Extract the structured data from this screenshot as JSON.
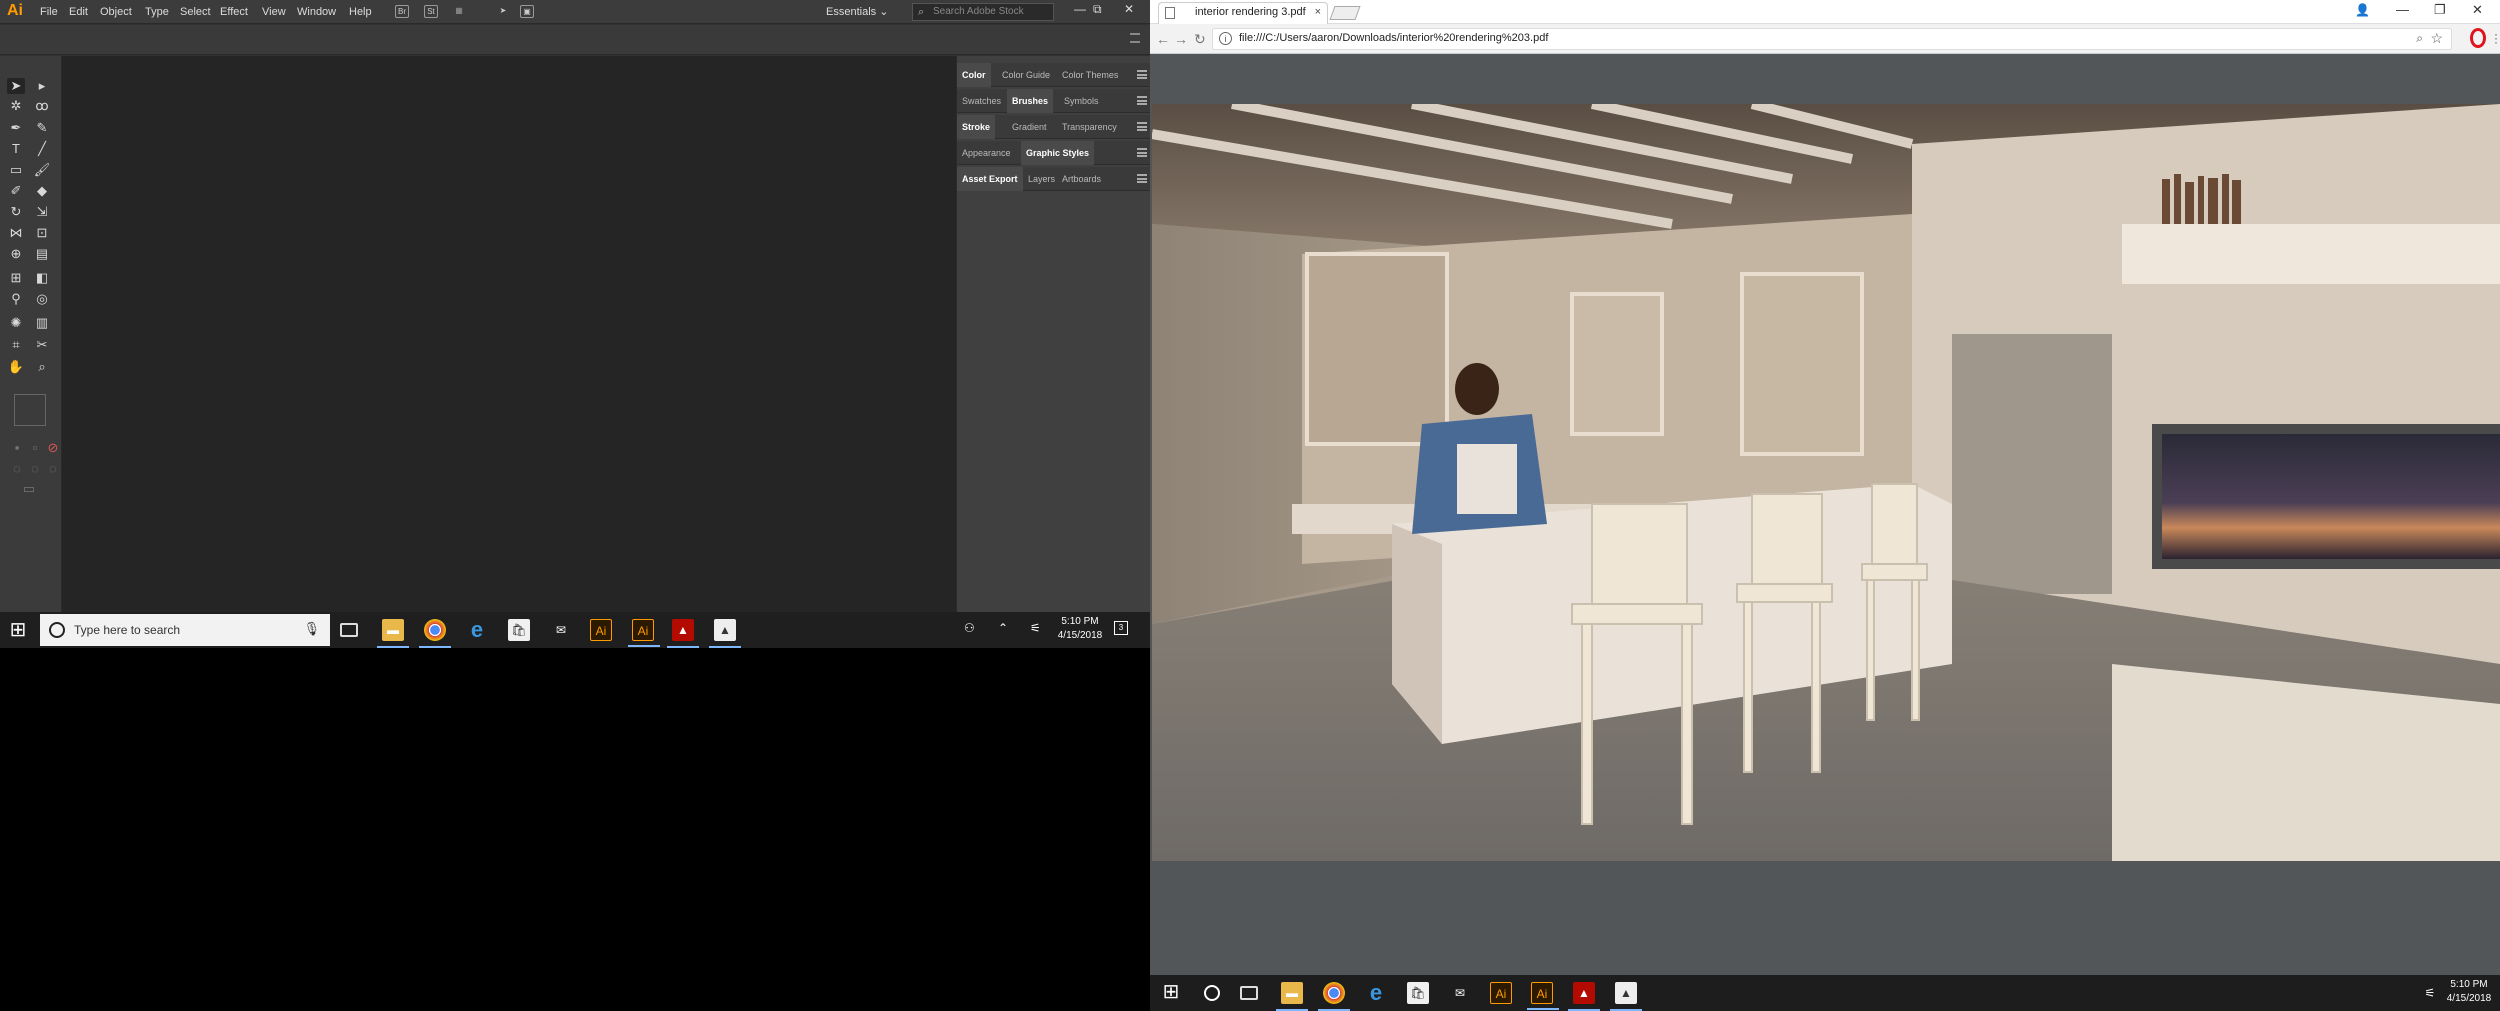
{
  "illustrator": {
    "logo": "Ai",
    "menus": [
      "File",
      "Edit",
      "Object",
      "Type",
      "Select",
      "Effect",
      "View",
      "Window",
      "Help"
    ],
    "toolbar_buttons": [
      "Br",
      "St"
    ],
    "workspace": "Essentials",
    "stock_search_placeholder": "Search Adobe Stock",
    "window_controls": [
      "—",
      "⧉",
      "✕"
    ],
    "panels": [
      {
        "tabs": [
          "Color",
          "Color Guide",
          "Color Themes"
        ],
        "active": 0
      },
      {
        "tabs": [
          "Swatches",
          "Brushes",
          "Symbols"
        ],
        "active": 1
      },
      {
        "tabs": [
          "Stroke",
          "Gradient",
          "Transparency"
        ],
        "active": 0
      },
      {
        "tabs": [
          "Appearance",
          "Graphic Styles"
        ],
        "active": 1
      },
      {
        "tabs": [
          "Asset Export",
          "Layers",
          "Artboards"
        ],
        "active": 0
      }
    ]
  },
  "taskbar_left": {
    "search_placeholder": "Type here to search",
    "time": "5:10 PM",
    "date": "4/15/2018",
    "app_icons": [
      "task-view",
      "file-explorer",
      "chrome",
      "edge",
      "store",
      "mail",
      "illustrator",
      "illustrator",
      "acrobat",
      "photos"
    ]
  },
  "chrome": {
    "tab_title": "interior rendering 3.pdf",
    "tab_close": "×",
    "url": "file:///C:/Users/aaron/Downloads/interior%20rendering%203.pdf",
    "window_controls": [
      "—",
      "❐",
      "✕"
    ]
  },
  "taskbar_right": {
    "time": "5:10 PM",
    "date": "4/15/2018"
  },
  "colors": {
    "illustrator_bg": "#323232",
    "canvas": "#252525",
    "ai_logo": "#ff9a00",
    "pdf_viewer_bg": "#525659",
    "taskbar": "#1f1f1f"
  }
}
